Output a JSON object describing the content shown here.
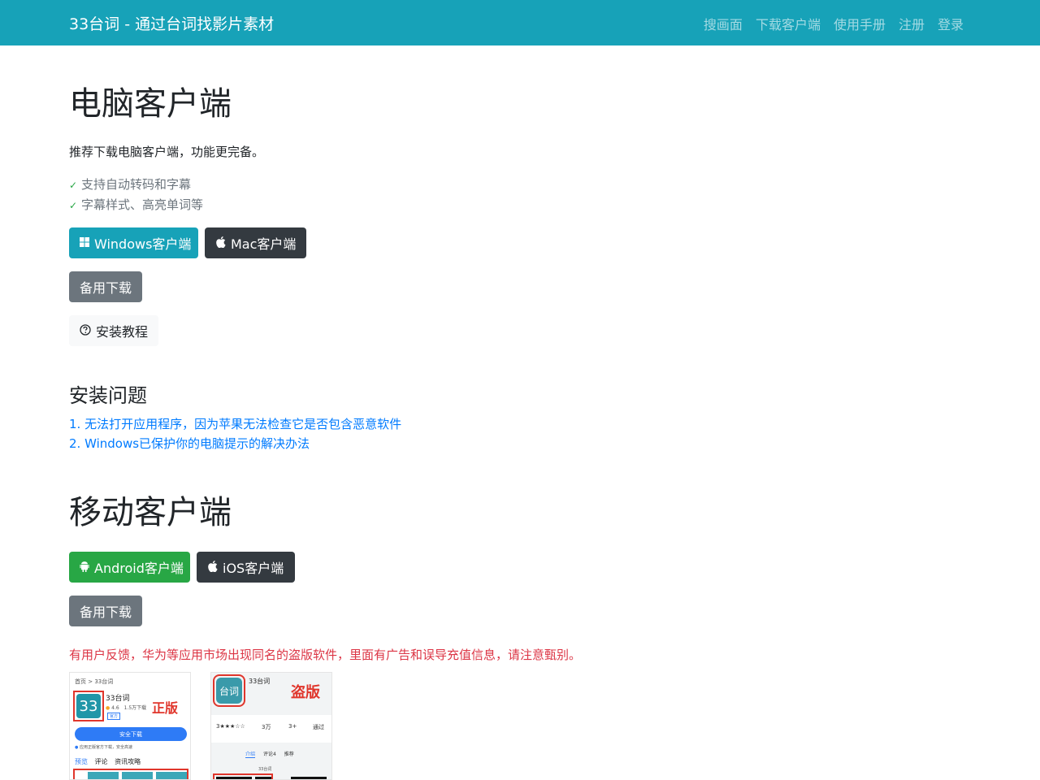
{
  "navbar": {
    "brand": "33台词 - 通过台词找影片素材",
    "links": [
      "搜画面",
      "下载客户端",
      "使用手册",
      "注册",
      "登录"
    ]
  },
  "desktop": {
    "title": "电脑客户端",
    "intro": "推荐下载电脑客户端，功能更完备。",
    "features": [
      "支持自动转码和字幕",
      "字幕样式、高亮单词等"
    ],
    "windows_button": "Windows客户端",
    "mac_button": "Mac客户端",
    "backup_button": "备用下载",
    "tutorial_button": "安装教程"
  },
  "install_issues": {
    "title": "安装问题",
    "links": [
      "1. 无法打开应用程序，因为苹果无法检查它是否包含恶意软件",
      "2. Windows已保护你的电脑提示的解决办法"
    ]
  },
  "mobile": {
    "title": "移动客户端",
    "android_button": "Android客户端",
    "ios_button": "iOS客户端",
    "backup_button": "备用下载",
    "warning": "有用户反馈，华为等应用市场出现同名的盗版软件，里面有广告和误导充值信息，请注意甄别。"
  },
  "screenshots": {
    "genuine": {
      "breadcrumb": "首页 > 33台词",
      "app_icon_text": "33",
      "app_name": "33台词",
      "rating": "4.6",
      "downloads": "1.5万下载",
      "badge": "官方",
      "label": "正版",
      "download_button": "安全下载",
      "notice": "应用正版官方下载，安全高速",
      "tabs": [
        "预览",
        "评论",
        "资讯攻略"
      ]
    },
    "pirated": {
      "app_icon_text": "台词",
      "app_name": "33台词",
      "label": "盗版",
      "stats": [
        "3★★★☆☆",
        "3万",
        "3+",
        "通过"
      ],
      "tabs": [
        "介绍",
        "评论4",
        "推荐"
      ],
      "footer_line": "33台词"
    }
  },
  "colors": {
    "navbar": "#17a2b8",
    "primary_link": "#007bff",
    "success": "#28a745",
    "dark": "#343a40",
    "secondary": "#6c757d",
    "danger": "#dc3545"
  }
}
